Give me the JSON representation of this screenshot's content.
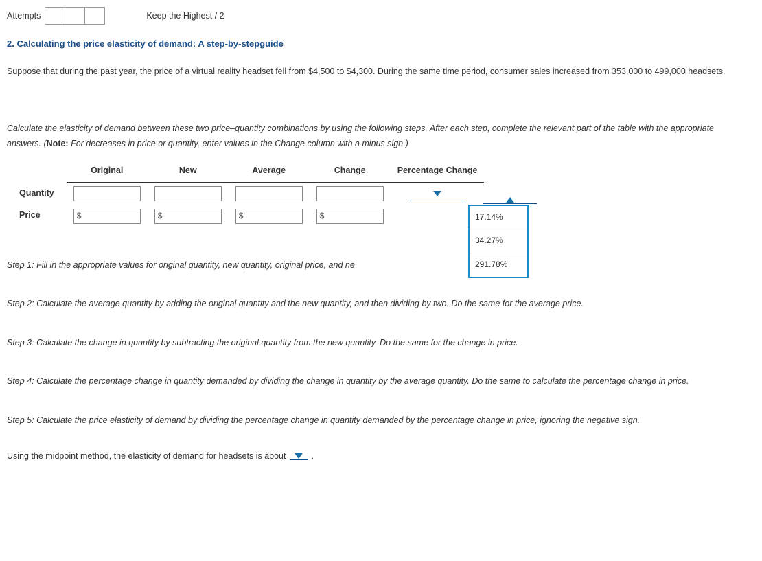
{
  "top": {
    "attempts_label": "Attempts",
    "keep_highest": "Keep the Highest / 2"
  },
  "title": "2. Calculating the price elasticity of demand: A step-by-stepguide",
  "intro": "Suppose that during the past year, the price of a virtual reality headset fell from $4,500 to $4,300. During the same time period, consumer sales increased from 353,000 to 499,000 headsets.",
  "instruction_preamble": "Calculate the elasticity of demand between these two price–quantity combinations by using the following steps. After each step, complete the relevant part of the table with the appropriate answers. (",
  "instruction_note_label": "Note:",
  "instruction_note_text": " For decreases in price or quantity, enter values in the Change column with a minus sign.)",
  "table": {
    "headers": {
      "original": "Original",
      "new": "New",
      "average": "Average",
      "change": "Change",
      "pct_change": "Percentage Change"
    },
    "rows": {
      "quantity": "Quantity",
      "price": "Price"
    },
    "price_prefix": "$"
  },
  "dropdown_options": [
    "17.14%",
    "34.27%",
    "291.78%"
  ],
  "steps": {
    "s1_a": "Step 1: Fill in the appropriate values for original quantity, new quantity, original price, and ne",
    "s2": "Step 2: Calculate the average quantity by adding the original quantity and the new quantity, and then dividing by two. Do the same for the average price.",
    "s3": "Step 3: Calculate the change in quantity by subtracting the original quantity from the new quantity. Do the same for the change in price.",
    "s4": "Step 4: Calculate the percentage change in quantity demanded by dividing the change in quantity by the average quantity. Do the same to calculate the percentage change in price.",
    "s5": "Step 5: Calculate the price elasticity of demand by dividing the percentage change in quantity demanded by the percentage change in price, ignoring the negative sign."
  },
  "final": {
    "pre": "Using the midpoint method, the elasticity of demand for headsets is about ",
    "post": " ."
  }
}
